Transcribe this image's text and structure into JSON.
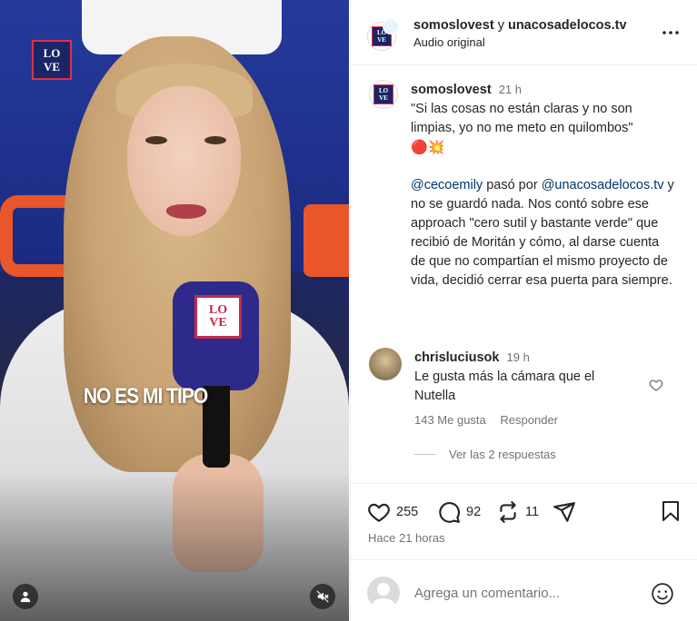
{
  "media": {
    "brand_logo_top": "LO",
    "brand_logo_bottom": "VE",
    "caption_text": "NO ES MI TIPO",
    "mic_logo_top": "LO",
    "mic_logo_bottom": "VE"
  },
  "header": {
    "author": "somoslovest",
    "connector": "y",
    "collaborator": "unacosadelocos.tv",
    "audio_label": "Audio original",
    "more_icon": "more-horizontal-icon"
  },
  "caption": {
    "author": "somoslovest",
    "time": "21 h",
    "quote": "\"Si las cosas no están claras y no son limpias, yo no me meto en quilombos\"",
    "emoji": "🔴💥",
    "mention1": "@cecoemily",
    "text1": " pasó por ",
    "mention2": "@unacosadelocos.tv",
    "text2": " y no se guardó nada. Nos contó sobre ese approach \"cero sutil y bastante verde\" que recibió de Moritán y cómo, al darse cuenta de que no compartían el mismo proyecto de vida, decidió cerrar esa puerta para siempre."
  },
  "comment": {
    "author": "chrisluciusok",
    "time": "19 h",
    "text": "Le gusta más la cámara que el Nutella",
    "likes": "143 Me gusta",
    "reply": "Responder",
    "view_replies": "Ver las 2 respuestas"
  },
  "actions": {
    "likes_count": "255",
    "comments_count": "92",
    "reposts_count": "11",
    "timestamp": "Hace 21 horas"
  },
  "add_comment": {
    "placeholder": "Agrega un comentario..."
  },
  "colors": {
    "link": "#00376b",
    "muted": "#737373",
    "brand_red": "#e03046",
    "brand_blue": "#1a2568"
  }
}
